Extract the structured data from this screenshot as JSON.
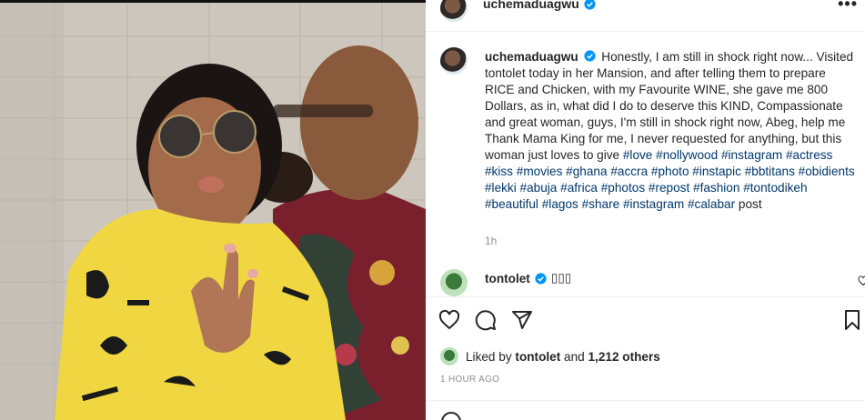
{
  "post": {
    "username": "uchemaduagwu",
    "more_icon": "more-horizontal-icon",
    "verified_color": "#0095f6",
    "photo_alt": "Photo"
  },
  "caption": {
    "username": "uchemaduagwu",
    "text": "Honestly, I am still in shock right now... Visited tontolet today in her Mansion, and after telling them to prepare RICE and Chicken, with my Favourite WINE, she gave me 800 Dollars, as in, what did I do to deserve this KIND, Compassionate and great woman, guys, I'm still in shock right now, Abeg, help me Thank Mama King for me, I never requested for anything, but this woman just loves to give ",
    "hashtags": [
      "#love",
      "#nollywood",
      "#instagram",
      "#actress",
      "#kiss",
      "#movies",
      "#ghana",
      "#accra",
      "#photo",
      "#instapic",
      "#bbtitans",
      "#obidients",
      "#lekki",
      "#abuja",
      "#africa",
      "#photos",
      "#repost",
      "#fashion",
      "#tontodikeh",
      "#beautiful",
      "#lagos",
      "#share",
      "#instagram",
      "#calabar"
    ],
    "suffix": " post",
    "time": "1h"
  },
  "comment": {
    "username": "tontolet",
    "text": "▯▯▯"
  },
  "actions": {
    "like_icon": "heart-icon",
    "comment_icon": "comment-icon",
    "share_icon": "share-icon",
    "save_icon": "bookmark-icon"
  },
  "likes": {
    "prefix": "Liked by ",
    "user": "tontolet",
    "middle": " and ",
    "count": "1,212 others"
  },
  "timestamp": "1 HOUR AGO",
  "colors": {
    "text": "#262626",
    "secondary": "#8e8e8e",
    "link": "#00376b",
    "verified": "#0095f6"
  }
}
